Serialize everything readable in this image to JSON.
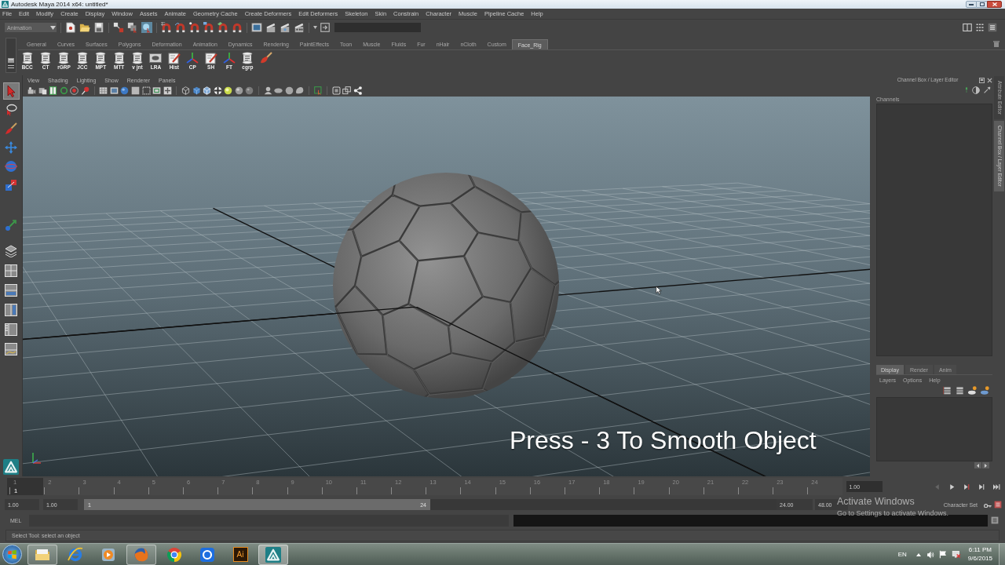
{
  "window": {
    "title": "Autodesk Maya 2014 x64: untitled*"
  },
  "menu_bar": [
    "File",
    "Edit",
    "Modify",
    "Create",
    "Display",
    "Window",
    "Assets",
    "Animate",
    "Geometry Cache",
    "Create Deformers",
    "Edit Deformers",
    "Skeleton",
    "Skin",
    "Constrain",
    "Character",
    "Muscle",
    "Pipeline Cache",
    "Help"
  ],
  "status_line": {
    "menu_set": "Animation"
  },
  "shelf": {
    "tabs": [
      {
        "label": "General",
        "selected": false
      },
      {
        "label": "Curves",
        "selected": false
      },
      {
        "label": "Surfaces",
        "selected": false
      },
      {
        "label": "Polygons",
        "selected": false
      },
      {
        "label": "Deformation",
        "selected": false
      },
      {
        "label": "Animation",
        "selected": false
      },
      {
        "label": "Dynamics",
        "selected": false
      },
      {
        "label": "Rendering",
        "selected": false
      },
      {
        "label": "PaintEffects",
        "selected": false
      },
      {
        "label": "Toon",
        "selected": false
      },
      {
        "label": "Muscle",
        "selected": false
      },
      {
        "label": "Fluids",
        "selected": false
      },
      {
        "label": "Fur",
        "selected": false
      },
      {
        "label": "nHair",
        "selected": false
      },
      {
        "label": "nCloth",
        "selected": false
      },
      {
        "label": "Custom",
        "selected": false
      },
      {
        "label": "Face_Rig",
        "selected": true
      }
    ],
    "buttons": [
      {
        "kind": "script",
        "label": "BCC"
      },
      {
        "kind": "script",
        "label": "CT"
      },
      {
        "kind": "script",
        "label": "rGRP"
      },
      {
        "kind": "script",
        "label": "JCC"
      },
      {
        "kind": "script",
        "label": "MPT"
      },
      {
        "kind": "script",
        "label": "MTT"
      },
      {
        "kind": "script",
        "label": "v jnt"
      },
      {
        "kind": "panel",
        "label": "LRA"
      },
      {
        "kind": "notes",
        "label": "Hist"
      },
      {
        "kind": "axes",
        "label": "CP"
      },
      {
        "kind": "notes",
        "label": "SH"
      },
      {
        "kind": "axes",
        "label": "FT"
      },
      {
        "kind": "script",
        "label": "cgrp"
      },
      {
        "kind": "brush"
      }
    ]
  },
  "toolbox": [
    {
      "kind": "select",
      "selected": true
    },
    {
      "kind": "lasso",
      "selected": false
    },
    {
      "kind": "paint",
      "selected": false
    },
    {
      "kind": "move",
      "selected": false
    },
    {
      "kind": "rotate",
      "selected": false
    },
    {
      "kind": "scale",
      "selected": false
    },
    {
      "kind": "manipulator",
      "selected": false
    },
    {
      "kind": "layout_single",
      "selected": false
    },
    {
      "kind": "layout_four",
      "selected": false
    },
    {
      "kind": "layout_two",
      "selected": false
    },
    {
      "kind": "layout_side",
      "selected": false
    },
    {
      "kind": "layout_outliner",
      "selected": false
    },
    {
      "kind": "layout_graph",
      "selected": false
    }
  ],
  "viewport": {
    "menu": [
      "View",
      "Shading",
      "Lighting",
      "Show",
      "Renderer",
      "Panels"
    ],
    "caption": "Press - 3 To Smooth Object"
  },
  "channel_box": {
    "title": "Channel Box / Layer Editor",
    "menu": [
      "Channels"
    ]
  },
  "layer_editor": {
    "tabs": [
      {
        "label": "Display",
        "selected": true
      },
      {
        "label": "Render",
        "selected": false
      },
      {
        "label": "Anim",
        "selected": false
      }
    ],
    "menu": [
      "Layers",
      "Options",
      "Help"
    ]
  },
  "side_tabs": [
    {
      "label": "Attribute Editor",
      "selected": false
    },
    {
      "label": "Channel Box / Layer Editor",
      "selected": true
    }
  ],
  "time_slider": {
    "ticks": [
      {
        "label": "1",
        "current": true
      },
      {
        "label": "2",
        "current": false
      },
      {
        "label": "3",
        "current": false
      },
      {
        "label": "4",
        "current": false
      },
      {
        "label": "5",
        "current": false
      },
      {
        "label": "6",
        "current": false
      },
      {
        "label": "7",
        "current": false
      },
      {
        "label": "8",
        "current": false
      },
      {
        "label": "9",
        "current": false
      },
      {
        "label": "10",
        "current": false
      },
      {
        "label": "11",
        "current": false
      },
      {
        "label": "12",
        "current": false
      },
      {
        "label": "13",
        "current": false
      },
      {
        "label": "14",
        "current": false
      },
      {
        "label": "15",
        "current": false
      },
      {
        "label": "16",
        "current": false
      },
      {
        "label": "17",
        "current": false
      },
      {
        "label": "18",
        "current": false
      },
      {
        "label": "19",
        "current": false
      },
      {
        "label": "20",
        "current": false
      },
      {
        "label": "21",
        "current": false
      },
      {
        "label": "22",
        "current": false
      },
      {
        "label": "23",
        "current": false
      },
      {
        "label": "24",
        "current": false
      }
    ],
    "current_frame": "1",
    "current_time": "1.00"
  },
  "range_slider": {
    "start_time": "1.00",
    "playback_start": "1.00",
    "range_start": "1",
    "range_end": "24",
    "level": 0.5,
    "playback_end": "24.00",
    "end_time": "48.00",
    "character_set": "Character Set"
  },
  "command_line": {
    "language": "MEL"
  },
  "help_line": "Select Tool: select an object",
  "activation_notice": {
    "title": "Activate Windows",
    "message": "Go to Settings to activate Windows."
  },
  "taskbar": {
    "apps": [
      {
        "kind": "explorer",
        "running": true,
        "selected": false
      },
      {
        "kind": "ie",
        "running": false,
        "selected": false
      },
      {
        "kind": "media",
        "running": false,
        "selected": false
      },
      {
        "kind": "firefox",
        "running": true,
        "selected": false
      },
      {
        "kind": "chrome",
        "running": false,
        "selected": false
      },
      {
        "kind": "maxthon",
        "running": false,
        "selected": false
      },
      {
        "kind": "illustrator",
        "label": "Ai",
        "running": false,
        "selected": false
      },
      {
        "kind": "maya",
        "running": true,
        "selected": true
      }
    ],
    "language": "EN",
    "time": "6:11 PM",
    "date": "9/6/2015"
  }
}
